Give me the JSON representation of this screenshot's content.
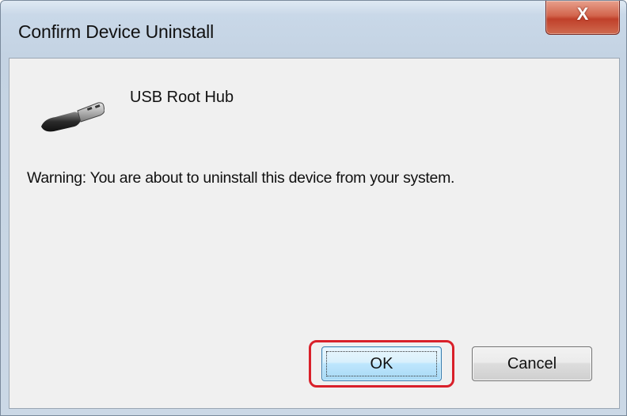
{
  "window": {
    "title": "Confirm Device Uninstall",
    "close_label": "X"
  },
  "device": {
    "icon": "usb-plug-icon",
    "name": "USB Root Hub"
  },
  "message": {
    "warning": "Warning: You are about to uninstall this device from your system."
  },
  "buttons": {
    "ok_label": "OK",
    "cancel_label": "Cancel"
  },
  "colors": {
    "highlight": "#d9202a",
    "close_button": "#c9503a",
    "default_button_border": "#3c7fb1"
  }
}
